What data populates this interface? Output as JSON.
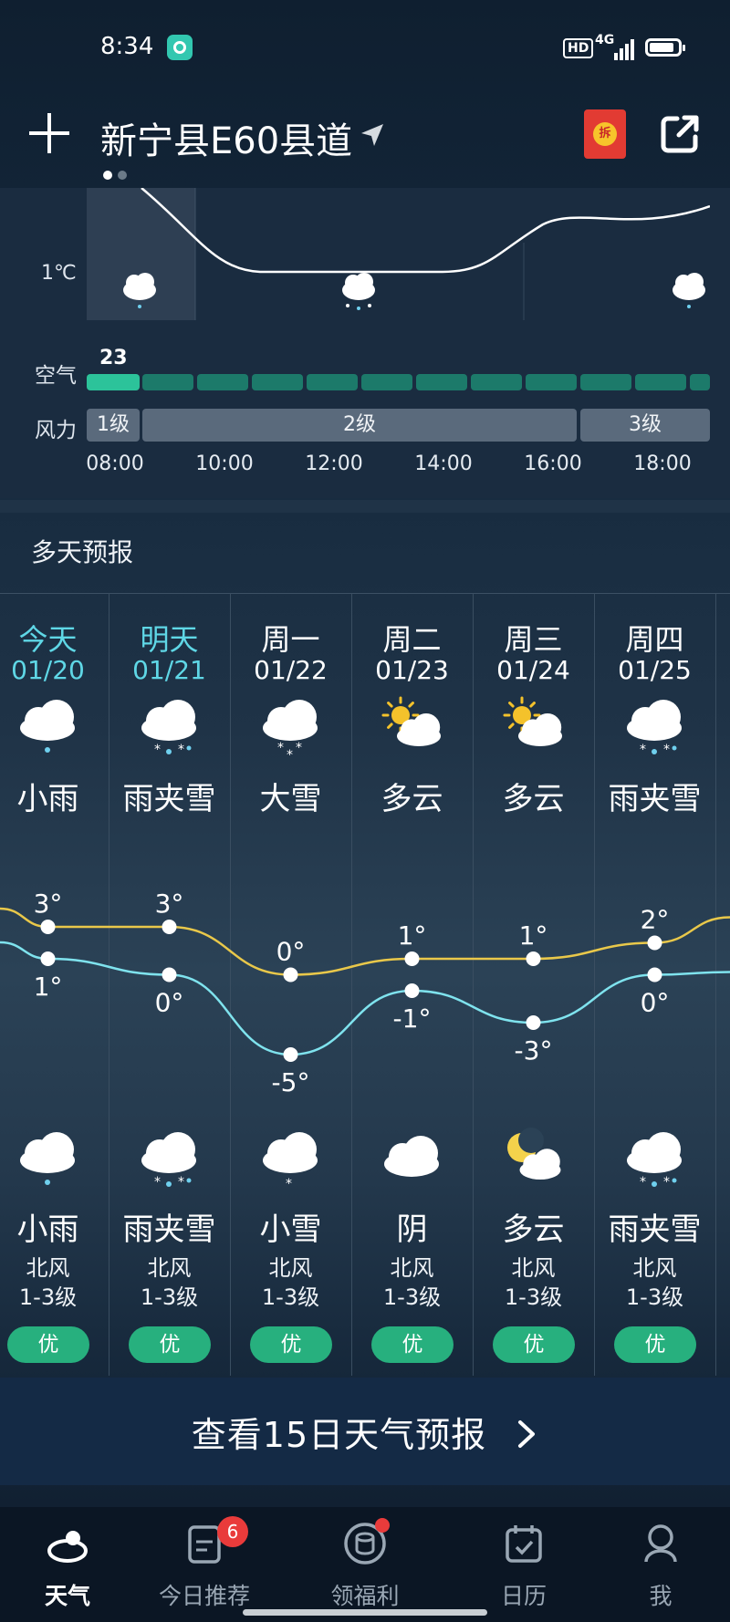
{
  "status": {
    "time": "8:34",
    "hd": "HD",
    "network": "4G"
  },
  "header": {
    "location": "新宁县E60县道",
    "redpack_text": "拆"
  },
  "hourly": {
    "temp_label": "1℃",
    "aqi_label": "空气",
    "aqi_value": "23",
    "wind_label": "风力",
    "wind_segments": [
      "1级",
      "2级",
      "3级"
    ],
    "hours": [
      "08:00",
      "10:00",
      "12:00",
      "14:00",
      "16:00",
      "18:00"
    ]
  },
  "daily": {
    "title": "多天预报",
    "days": [
      {
        "day": "今天",
        "date": "01/20",
        "day_weather": "小雨",
        "day_icon": "rain-cloud-icon",
        "high": "3°",
        "low": "1°",
        "night_weather": "小雨",
        "night_icon": "rain-cloud-icon",
        "wind_dir": "北风",
        "wind_level": "1-3级",
        "aqi": "优",
        "highlight": true
      },
      {
        "day": "明天",
        "date": "01/21",
        "day_weather": "雨夹雪",
        "day_icon": "sleet-cloud-icon",
        "high": "3°",
        "low": "0°",
        "night_weather": "雨夹雪",
        "night_icon": "sleet-cloud-icon",
        "wind_dir": "北风",
        "wind_level": "1-3级",
        "aqi": "优",
        "highlight": true
      },
      {
        "day": "周一",
        "date": "01/22",
        "day_weather": "大雪",
        "day_icon": "heavy-snow-cloud-icon",
        "high": "0°",
        "low": "-5°",
        "night_weather": "小雪",
        "night_icon": "light-snow-cloud-icon",
        "wind_dir": "北风",
        "wind_level": "1-3级",
        "aqi": "优",
        "highlight": false
      },
      {
        "day": "周二",
        "date": "01/23",
        "day_weather": "多云",
        "day_icon": "partly-cloudy-sun-icon",
        "high": "1°",
        "low": "-1°",
        "night_weather": "阴",
        "night_icon": "overcast-cloud-icon",
        "wind_dir": "北风",
        "wind_level": "1-3级",
        "aqi": "优",
        "highlight": false
      },
      {
        "day": "周三",
        "date": "01/24",
        "day_weather": "多云",
        "day_icon": "partly-cloudy-sun-icon",
        "high": "1°",
        "low": "-3°",
        "night_weather": "多云",
        "night_icon": "partly-cloudy-moon-icon",
        "wind_dir": "北风",
        "wind_level": "1-3级",
        "aqi": "优",
        "highlight": false
      },
      {
        "day": "周四",
        "date": "01/25",
        "day_weather": "雨夹雪",
        "day_icon": "sleet-cloud-icon",
        "high": "2°",
        "low": "0°",
        "night_weather": "雨夹雪",
        "night_icon": "sleet-cloud-icon",
        "wind_dir": "北风",
        "wind_level": "1-3级",
        "aqi": "优",
        "highlight": false
      }
    ]
  },
  "more_button": "查看15日天气预报",
  "nav": {
    "items": [
      {
        "label": "天气",
        "icon": "cloud-weather-icon",
        "active": true
      },
      {
        "label": "今日推荐",
        "icon": "recommend-doc-icon",
        "active": false
      },
      {
        "label": "领福利",
        "icon": "coin-stack-icon",
        "active": false
      },
      {
        "label": "日历",
        "icon": "calendar-icon",
        "active": false
      },
      {
        "label": "我",
        "icon": "profile-icon",
        "active": false
      }
    ],
    "recommend_badge": "6"
  },
  "colors": {
    "aqi_good": "#27b07e",
    "high_line": "#e9c84a",
    "low_line": "#7fe3ee",
    "highlight_text": "#5fd7e6"
  }
}
